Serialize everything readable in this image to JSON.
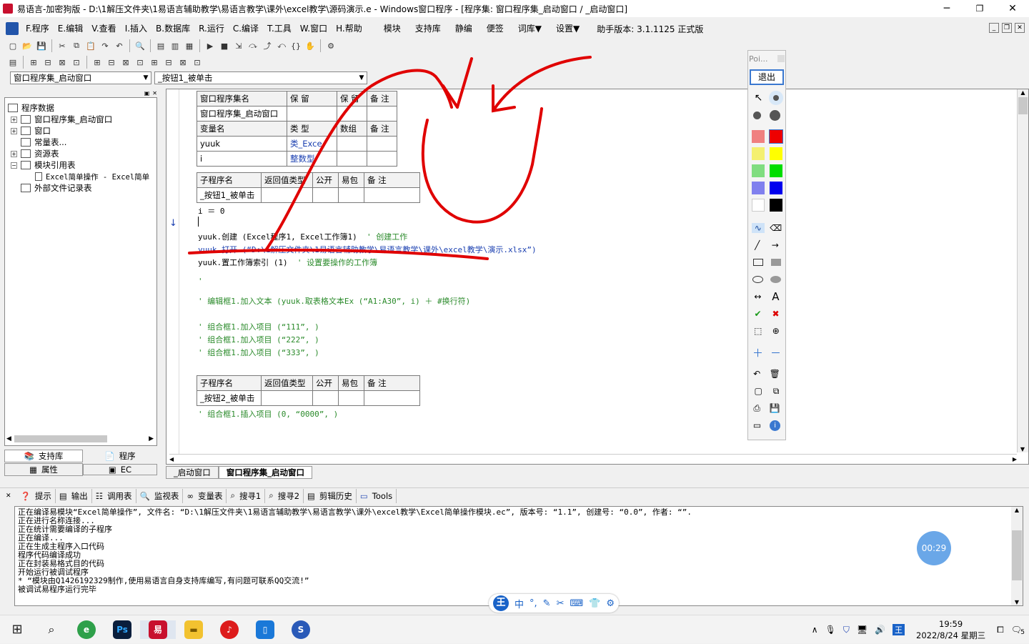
{
  "window": {
    "title": "易语言-加密狗版 - D:\\1解压文件夹\\1易语言辅助教学\\易语言教学\\课外\\excel教学\\源码演示.e - Windows窗口程序 - [程序集: 窗口程序集_启动窗口 / _启动窗口]"
  },
  "menu": {
    "items": [
      "F.程序",
      "E.编辑",
      "V.查看",
      "I.插入",
      "B.数据库",
      "R.运行",
      "C.编译",
      "T.工具",
      "W.窗口",
      "H.帮助"
    ],
    "extras": [
      "模块",
      "支持库",
      "静编",
      "便签",
      "词库▼",
      "设置▼"
    ],
    "version": "助手版本: 3.1.1125 正式版"
  },
  "selectors": {
    "assembly": "窗口程序集_启动窗口",
    "subroutine": "_按钮1_被单击"
  },
  "tree": {
    "root": "程序数据",
    "items": [
      "窗口程序集_启动窗口",
      "窗口",
      "常量表...",
      "资源表",
      "模块引用表",
      "Excel简单操作 - Excel简单",
      "外部文件记录表"
    ]
  },
  "left_tabs": {
    "support": "支持库",
    "program": "程序",
    "props": "属性",
    "ec": "EC"
  },
  "code": {
    "assembly_table": {
      "headers": [
        "窗口程序集名",
        "保 留",
        "保 留",
        "备 注"
      ],
      "row": [
        "窗口程序集_启动窗口",
        "",
        "",
        ""
      ]
    },
    "var_table": {
      "headers": [
        "变量名",
        "类 型",
        "数组",
        "备 注"
      ],
      "rows": [
        [
          "yuuk",
          "类_Exce",
          "",
          ""
        ],
        [
          "i",
          "整数型",
          "",
          ""
        ]
      ]
    },
    "sub1_table": {
      "headers": [
        "子程序名",
        "返回值类型",
        "公开",
        "易包",
        "备 注"
      ],
      "row": [
        "_按钮1_被单击",
        "",
        "",
        "",
        ""
      ]
    },
    "lines": [
      "i ＝ 0",
      "yuuk.创建 (Excel程序1, Excel工作簿1)",
      "' 创建工作",
      "yuuk.打开 (“D:\\1解压文件夹\\1易语言辅助教学\\易语言教学\\课外\\excel教学\\演示.xlsx”)",
      "yuuk.置工作簿索引 (1)",
      "' 设置要操作的工作簿",
      "'",
      "' 编辑框1.加入文本 (yuuk.取表格文本Ex (“A1:A30”, i) ＋ #换行符)",
      "' 组合框1.加入项目 (“111”, )",
      "' 组合框1.加入项目 (“222”, )",
      "' 组合框1.加入项目 (“333”, )"
    ],
    "sub2_table": {
      "headers": [
        "子程序名",
        "返回值类型",
        "公开",
        "易包",
        "备 注"
      ],
      "row": [
        "_按钮2_被单击",
        "",
        "",
        "",
        ""
      ]
    },
    "last_line": "' 组合框1.插入项目 (0, “0000”, )"
  },
  "editor_tabs": [
    "_启动窗口",
    "窗口程序集_启动窗口"
  ],
  "bottom_tabs": [
    "提示",
    "输出",
    "调用表",
    "监视表",
    "变量表",
    "搜寻1",
    "搜寻2",
    "剪辑历史",
    "Tools"
  ],
  "output": [
    "正在编译易模块“Excel简单操作”, 文件名: “D:\\1解压文件夹\\1易语言辅助教学\\易语言教学\\课外\\excel教学\\Excel简单操作模块.ec”, 版本号: “1.1”, 创建号: “0.0”, 作者: “”.",
    "正在进行名称连接...",
    "正在统计需要编译的子程序",
    "正在编译...",
    "正在生成主程序入口代码",
    "程序代码编译成功",
    "正在封装易格式目的代码",
    "开始运行被调试程序",
    "* “模块由Q1426192329制作,使用易语言自身支持库编写,有问题可联系QQ交流!”",
    "被调试易程序运行完毕"
  ],
  "pointer_panel": {
    "title": "Poi...",
    "exit": "退出"
  },
  "timer": "00:29",
  "taskbar": {
    "time": "19:59",
    "date": "2022/8/24 星期三",
    "notif_count": "5",
    "ime": "中"
  },
  "colors": {
    "annotation": "#e00000",
    "accent": "#0a64d2",
    "title_bg": "#ffffff"
  }
}
